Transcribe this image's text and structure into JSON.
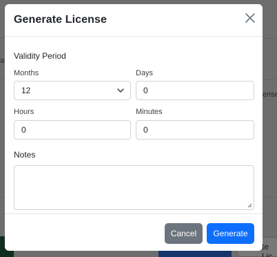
{
  "modal": {
    "title": "Generate License",
    "section_label": "Validity Period",
    "months": {
      "label": "Months",
      "value": "12"
    },
    "days": {
      "label": "Days",
      "value": "0"
    },
    "hours": {
      "label": "Hours",
      "value": "0"
    },
    "minutes": {
      "label": "Minutes",
      "value": "0"
    },
    "notes": {
      "label": "Notes",
      "value": ""
    },
    "cancel_label": "Cancel",
    "generate_label": "Generate"
  },
  "background": {
    "right_text_1": "enses",
    "right_text_2": "te Lic",
    "left_fragment": "a"
  },
  "colors": {
    "primary": "#0d6efd",
    "secondary": "#6c757d",
    "overlay": "rgba(0,0,0,0.5)"
  }
}
